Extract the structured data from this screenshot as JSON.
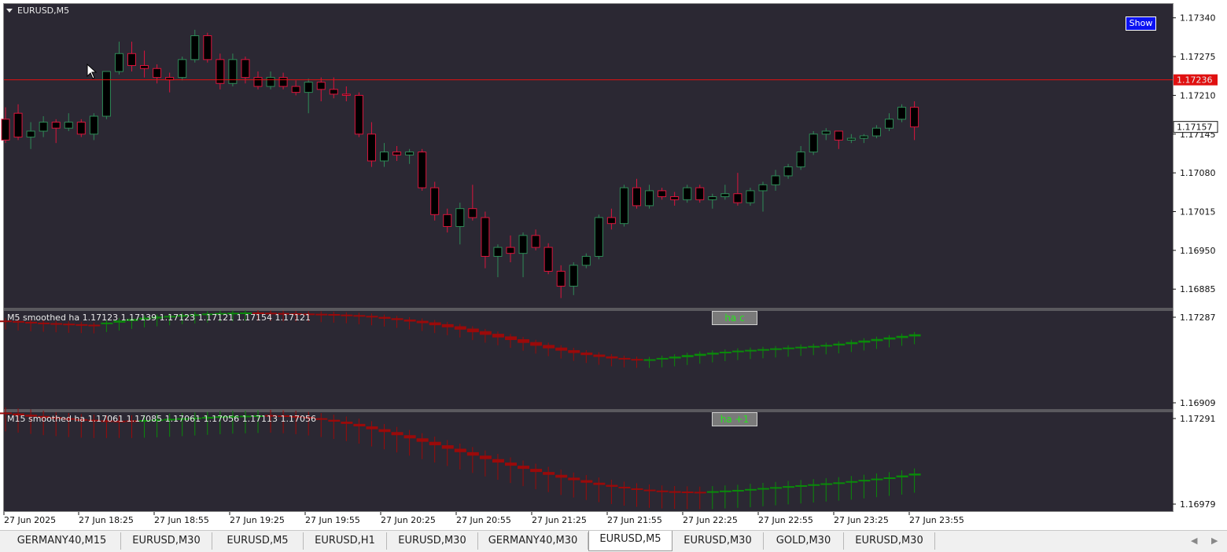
{
  "chart": {
    "symbol": "EURUSD,M5",
    "show_button": "Show",
    "price_line_label": "1.17236",
    "bid_label": "1.17157",
    "price_ticks": [
      "1.17340",
      "1.17275",
      "1.17210",
      "1.17145",
      "1.17080",
      "1.17015",
      "1.16950",
      "1.16885"
    ],
    "colors": {
      "bg": "#2b2833",
      "bull": "#2e8b57",
      "bear": "#dc143c",
      "price_line": "#e01010"
    }
  },
  "indicator1": {
    "label": "M5 smoothed ha  1.17123 1.17139 1.17123 1.17121 1.17154 1.17121",
    "button": "ha c",
    "ticks": [
      "1.17287",
      "1.16909"
    ]
  },
  "indicator2": {
    "label": "M15 smoothed ha  1.17061 1.17085 1.17061 1.17056 1.17113 1.17056",
    "button": "ha +1",
    "ticks": [
      "1.17291",
      "1.16979"
    ]
  },
  "time_axis": [
    "27 Jun 2025",
    "27 Jun 18:25",
    "27 Jun 18:55",
    "27 Jun 19:25",
    "27 Jun 19:55",
    "27 Jun 20:25",
    "27 Jun 20:55",
    "27 Jun 21:25",
    "27 Jun 21:55",
    "27 Jun 22:25",
    "27 Jun 22:55",
    "27 Jun 23:25",
    "27 Jun 23:55"
  ],
  "tabs": [
    {
      "label": "GERMANY40,M15",
      "active": false
    },
    {
      "label": "EURUSD,M30",
      "active": false
    },
    {
      "label": "EURUSD,M5",
      "active": false
    },
    {
      "label": "EURUSD,H1",
      "active": false
    },
    {
      "label": "EURUSD,M30",
      "active": false
    },
    {
      "label": "GERMANY40,M30",
      "active": false
    },
    {
      "label": "EURUSD,M5",
      "active": true
    },
    {
      "label": "EURUSD,M30",
      "active": false
    },
    {
      "label": "GOLD,M30",
      "active": false
    },
    {
      "label": "EURUSD,M30",
      "active": false
    }
  ],
  "tab_scroll": {
    "left": "◀",
    "right": "▶"
  },
  "chart_data": {
    "type": "candlestick",
    "price_range": [
      1.16855,
      1.17362
    ],
    "ha1_range": [
      1.16909,
      1.17287
    ],
    "ha2_range": [
      1.16979,
      1.17291
    ],
    "price_line": 1.17236,
    "candles": [
      [
        1.1717,
        1.1719,
        1.1713,
        1.17135
      ],
      [
        1.1718,
        1.17195,
        1.17135,
        1.1714
      ],
      [
        1.1714,
        1.17165,
        1.1712,
        1.1715
      ],
      [
        1.1715,
        1.17175,
        1.1714,
        1.17165
      ],
      [
        1.17165,
        1.1717,
        1.1713,
        1.17155
      ],
      [
        1.17155,
        1.1718,
        1.1715,
        1.17165
      ],
      [
        1.17165,
        1.1717,
        1.1714,
        1.17145
      ],
      [
        1.17145,
        1.1718,
        1.17135,
        1.17175
      ],
      [
        1.17175,
        1.1725,
        1.1717,
        1.1725
      ],
      [
        1.1725,
        1.173,
        1.17245,
        1.1728
      ],
      [
        1.1728,
        1.173,
        1.1725,
        1.1726
      ],
      [
        1.1726,
        1.17285,
        1.1724,
        1.17255
      ],
      [
        1.17255,
        1.17262,
        1.1723,
        1.1724
      ],
      [
        1.1724,
        1.17248,
        1.17215,
        1.17236
      ],
      [
        1.1724,
        1.17275,
        1.17235,
        1.1727
      ],
      [
        1.1727,
        1.1732,
        1.17265,
        1.1731
      ],
      [
        1.1731,
        1.17315,
        1.17265,
        1.1727
      ],
      [
        1.1727,
        1.1728,
        1.1722,
        1.1723
      ],
      [
        1.1723,
        1.1728,
        1.17225,
        1.1727
      ],
      [
        1.1727,
        1.17275,
        1.1723,
        1.1724
      ],
      [
        1.1724,
        1.1725,
        1.1722,
        1.17225
      ],
      [
        1.17225,
        1.1725,
        1.1722,
        1.1724
      ],
      [
        1.1724,
        1.17248,
        1.1722,
        1.17225
      ],
      [
        1.17225,
        1.17235,
        1.1721,
        1.17215
      ],
      [
        1.17215,
        1.17238,
        1.1718,
        1.17232
      ],
      [
        1.17232,
        1.1724,
        1.172,
        1.1722
      ],
      [
        1.1722,
        1.1724,
        1.17205,
        1.17212
      ],
      [
        1.17212,
        1.17225,
        1.172,
        1.1721
      ],
      [
        1.1721,
        1.17215,
        1.1714,
        1.17145
      ],
      [
        1.17145,
        1.17165,
        1.1709,
        1.171
      ],
      [
        1.171,
        1.1713,
        1.1709,
        1.17115
      ],
      [
        1.17115,
        1.17125,
        1.171,
        1.1711
      ],
      [
        1.1711,
        1.1712,
        1.17095,
        1.17115
      ],
      [
        1.17115,
        1.1712,
        1.1705,
        1.17055
      ],
      [
        1.17055,
        1.17065,
        1.17,
        1.1701
      ],
      [
        1.1701,
        1.1702,
        1.1698,
        1.1699
      ],
      [
        1.1699,
        1.1703,
        1.1696,
        1.1702
      ],
      [
        1.1702,
        1.1706,
        1.17,
        1.17005
      ],
      [
        1.17005,
        1.17015,
        1.1692,
        1.1694
      ],
      [
        1.1694,
        1.1696,
        1.16905,
        1.16955
      ],
      [
        1.16955,
        1.16975,
        1.1693,
        1.16945
      ],
      [
        1.16945,
        1.1698,
        1.16905,
        1.16975
      ],
      [
        1.16975,
        1.16985,
        1.1695,
        1.16955
      ],
      [
        1.16955,
        1.16962,
        1.1691,
        1.16915
      ],
      [
        1.16915,
        1.16925,
        1.1687,
        1.1689
      ],
      [
        1.1689,
        1.1693,
        1.16875,
        1.16925
      ],
      [
        1.16925,
        1.16945,
        1.1692,
        1.1694
      ],
      [
        1.1694,
        1.1701,
        1.16935,
        1.17005
      ],
      [
        1.17005,
        1.1702,
        1.16985,
        1.16995
      ],
      [
        1.16995,
        1.1706,
        1.1699,
        1.17055
      ],
      [
        1.17055,
        1.1707,
        1.1702,
        1.17025
      ],
      [
        1.17025,
        1.1706,
        1.1702,
        1.1705
      ],
      [
        1.1705,
        1.17055,
        1.17035,
        1.1704
      ],
      [
        1.1704,
        1.17048,
        1.17025,
        1.17035
      ],
      [
        1.17035,
        1.1706,
        1.1703,
        1.17055
      ],
      [
        1.17055,
        1.1706,
        1.1703,
        1.17035
      ],
      [
        1.17035,
        1.17045,
        1.1702,
        1.1704
      ],
      [
        1.1704,
        1.1706,
        1.17035,
        1.17045
      ],
      [
        1.17045,
        1.1708,
        1.17025,
        1.1703
      ],
      [
        1.1703,
        1.17055,
        1.17025,
        1.1705
      ],
      [
        1.1705,
        1.17065,
        1.17015,
        1.1706
      ],
      [
        1.1706,
        1.17085,
        1.1705,
        1.17075
      ],
      [
        1.17075,
        1.17095,
        1.1707,
        1.1709
      ],
      [
        1.1709,
        1.17125,
        1.17085,
        1.17115
      ],
      [
        1.17115,
        1.1715,
        1.1711,
        1.17145
      ],
      [
        1.17145,
        1.17155,
        1.17135,
        1.1715
      ],
      [
        1.1715,
        1.1715,
        1.1712,
        1.17135
      ],
      [
        1.17135,
        1.17145,
        1.1713,
        1.17138
      ],
      [
        1.17138,
        1.17145,
        1.1713,
        1.17142
      ],
      [
        1.17142,
        1.1716,
        1.17138,
        1.17155
      ],
      [
        1.17155,
        1.1718,
        1.1715,
        1.1717
      ],
      [
        1.1717,
        1.17195,
        1.17165,
        1.1719
      ],
      [
        1.1719,
        1.172,
        1.17135,
        1.17157
      ]
    ],
    "ha_m5": [
      [
        1.1725,
        1.17246,
        0
      ],
      [
        1.17248,
        1.17242,
        0
      ],
      [
        1.17245,
        1.17239,
        0
      ],
      [
        1.17242,
        1.17237,
        0
      ],
      [
        1.1724,
        1.17235,
        0
      ],
      [
        1.17238,
        1.17233,
        0
      ],
      [
        1.17236,
        1.17232,
        0
      ],
      [
        1.17234,
        1.17231,
        0
      ],
      [
        1.17236,
        1.17242,
        1
      ],
      [
        1.17242,
        1.1725,
        1
      ],
      [
        1.17248,
        1.17256,
        1
      ],
      [
        1.17254,
        1.17261,
        1
      ],
      [
        1.17258,
        1.17265,
        1
      ],
      [
        1.17262,
        1.17268,
        1
      ],
      [
        1.17266,
        1.17271,
        1
      ],
      [
        1.17269,
        1.17274,
        1
      ],
      [
        1.17272,
        1.17277,
        1
      ],
      [
        1.17275,
        1.17279,
        1
      ],
      [
        1.17277,
        1.1728,
        1
      ],
      [
        1.17279,
        1.17281,
        1
      ],
      [
        1.17281,
        1.17279,
        0
      ],
      [
        1.1728,
        1.17278,
        0
      ],
      [
        1.17279,
        1.17277,
        0
      ],
      [
        1.17278,
        1.17276,
        0
      ],
      [
        1.17277,
        1.17275,
        0
      ],
      [
        1.17276,
        1.17274,
        0
      ],
      [
        1.17275,
        1.17272,
        0
      ],
      [
        1.17273,
        1.1727,
        0
      ],
      [
        1.17271,
        1.17266,
        0
      ],
      [
        1.17268,
        1.17262,
        0
      ],
      [
        1.17264,
        1.17257,
        0
      ],
      [
        1.17259,
        1.17252,
        0
      ],
      [
        1.17254,
        1.17246,
        0
      ],
      [
        1.17249,
        1.1724,
        0
      ],
      [
        1.17243,
        1.17232,
        0
      ],
      [
        1.17236,
        1.17224,
        0
      ],
      [
        1.17228,
        1.17215,
        0
      ],
      [
        1.17219,
        1.17205,
        0
      ],
      [
        1.17209,
        1.17195,
        0
      ],
      [
        1.17199,
        1.17185,
        0
      ],
      [
        1.17189,
        1.17175,
        0
      ],
      [
        1.17178,
        1.17164,
        0
      ],
      [
        1.17167,
        1.17153,
        0
      ],
      [
        1.17156,
        1.17143,
        0
      ],
      [
        1.17146,
        1.17134,
        0
      ],
      [
        1.17136,
        1.17125,
        0
      ],
      [
        1.17127,
        1.17117,
        0
      ],
      [
        1.17119,
        1.1711,
        0
      ],
      [
        1.17112,
        1.17104,
        0
      ],
      [
        1.17106,
        1.171,
        0
      ],
      [
        1.17102,
        1.17098,
        0
      ],
      [
        1.17098,
        1.17101,
        1
      ],
      [
        1.171,
        1.17106,
        1
      ],
      [
        1.17104,
        1.17111,
        1
      ],
      [
        1.17109,
        1.17117,
        1
      ],
      [
        1.17114,
        1.17122,
        1
      ],
      [
        1.17119,
        1.17126,
        1
      ],
      [
        1.17124,
        1.1713,
        1
      ],
      [
        1.17128,
        1.17134,
        1
      ],
      [
        1.17132,
        1.17137,
        1
      ],
      [
        1.17135,
        1.1714,
        1
      ],
      [
        1.17138,
        1.17143,
        1
      ],
      [
        1.17141,
        1.17146,
        1
      ],
      [
        1.17144,
        1.17149,
        1
      ],
      [
        1.17147,
        1.17152,
        1
      ],
      [
        1.1715,
        1.17156,
        1
      ],
      [
        1.17154,
        1.17161,
        1
      ],
      [
        1.17159,
        1.17167,
        1
      ],
      [
        1.17165,
        1.17173,
        1
      ],
      [
        1.17171,
        1.17179,
        1
      ],
      [
        1.17177,
        1.17185,
        1
      ],
      [
        1.17183,
        1.17191,
        1
      ],
      [
        1.17189,
        1.17197,
        1
      ]
    ],
    "ha_m15": [
      [
        1.1729,
        1.17285,
        0
      ],
      [
        1.17287,
        1.17281,
        0
      ],
      [
        1.17283,
        1.17277,
        0
      ],
      [
        1.17279,
        1.17273,
        0
      ],
      [
        1.17275,
        1.1727,
        0
      ],
      [
        1.17272,
        1.17267,
        0
      ],
      [
        1.17269,
        1.17265,
        0
      ],
      [
        1.17267,
        1.17264,
        0
      ],
      [
        1.17265,
        1.17264,
        0
      ],
      [
        1.17264,
        1.17264,
        0
      ],
      [
        1.17264,
        1.17265,
        0
      ],
      [
        1.17265,
        1.17266,
        1
      ],
      [
        1.17266,
        1.17268,
        1
      ],
      [
        1.17268,
        1.1727,
        1
      ],
      [
        1.1727,
        1.17272,
        1
      ],
      [
        1.17272,
        1.17274,
        1
      ],
      [
        1.17274,
        1.17276,
        1
      ],
      [
        1.17276,
        1.17278,
        1
      ],
      [
        1.17278,
        1.17279,
        1
      ],
      [
        1.17279,
        1.1728,
        1
      ],
      [
        1.1728,
        1.17281,
        1
      ],
      [
        1.17282,
        1.17281,
        0
      ],
      [
        1.17281,
        1.17279,
        0
      ],
      [
        1.17279,
        1.17276,
        0
      ],
      [
        1.17276,
        1.17272,
        0
      ],
      [
        1.17272,
        1.17267,
        0
      ],
      [
        1.17267,
        1.17261,
        0
      ],
      [
        1.17261,
        1.17254,
        0
      ],
      [
        1.17254,
        1.17246,
        0
      ],
      [
        1.17246,
        1.17237,
        0
      ],
      [
        1.17237,
        1.17228,
        0
      ],
      [
        1.17228,
        1.17218,
        0
      ],
      [
        1.17218,
        1.17208,
        0
      ],
      [
        1.17208,
        1.17197,
        0
      ],
      [
        1.17197,
        1.17186,
        0
      ],
      [
        1.17186,
        1.17175,
        0
      ],
      [
        1.17175,
        1.17164,
        0
      ],
      [
        1.17164,
        1.17153,
        0
      ],
      [
        1.17153,
        1.17142,
        0
      ],
      [
        1.17142,
        1.17131,
        0
      ],
      [
        1.17131,
        1.17121,
        0
      ],
      [
        1.17121,
        1.17111,
        0
      ],
      [
        1.17111,
        1.17101,
        0
      ],
      [
        1.17101,
        1.17092,
        0
      ],
      [
        1.17092,
        1.17083,
        0
      ],
      [
        1.17083,
        1.17075,
        0
      ],
      [
        1.17075,
        1.17067,
        0
      ],
      [
        1.17067,
        1.1706,
        0
      ],
      [
        1.1706,
        1.17054,
        0
      ],
      [
        1.17054,
        1.17049,
        0
      ],
      [
        1.17049,
        1.17045,
        0
      ],
      [
        1.17045,
        1.17042,
        0
      ],
      [
        1.17042,
        1.1704,
        0
      ],
      [
        1.1704,
        1.17039,
        0
      ],
      [
        1.17039,
        1.17038,
        0
      ],
      [
        1.17038,
        1.17038,
        0
      ],
      [
        1.17038,
        1.1704,
        1
      ],
      [
        1.1704,
        1.17042,
        1
      ],
      [
        1.17042,
        1.17044,
        1
      ],
      [
        1.17044,
        1.17047,
        1
      ],
      [
        1.17047,
        1.1705,
        1
      ],
      [
        1.1705,
        1.17053,
        1
      ],
      [
        1.17053,
        1.17056,
        1
      ],
      [
        1.17056,
        1.17059,
        1
      ],
      [
        1.17059,
        1.17062,
        1
      ],
      [
        1.17062,
        1.17065,
        1
      ],
      [
        1.17065,
        1.17068,
        1
      ],
      [
        1.17068,
        1.17072,
        1
      ],
      [
        1.17072,
        1.17076,
        1
      ],
      [
        1.17076,
        1.1708,
        1
      ],
      [
        1.1708,
        1.17084,
        1
      ],
      [
        1.17084,
        1.1709,
        1
      ],
      [
        1.1709,
        1.17096,
        1
      ]
    ]
  }
}
